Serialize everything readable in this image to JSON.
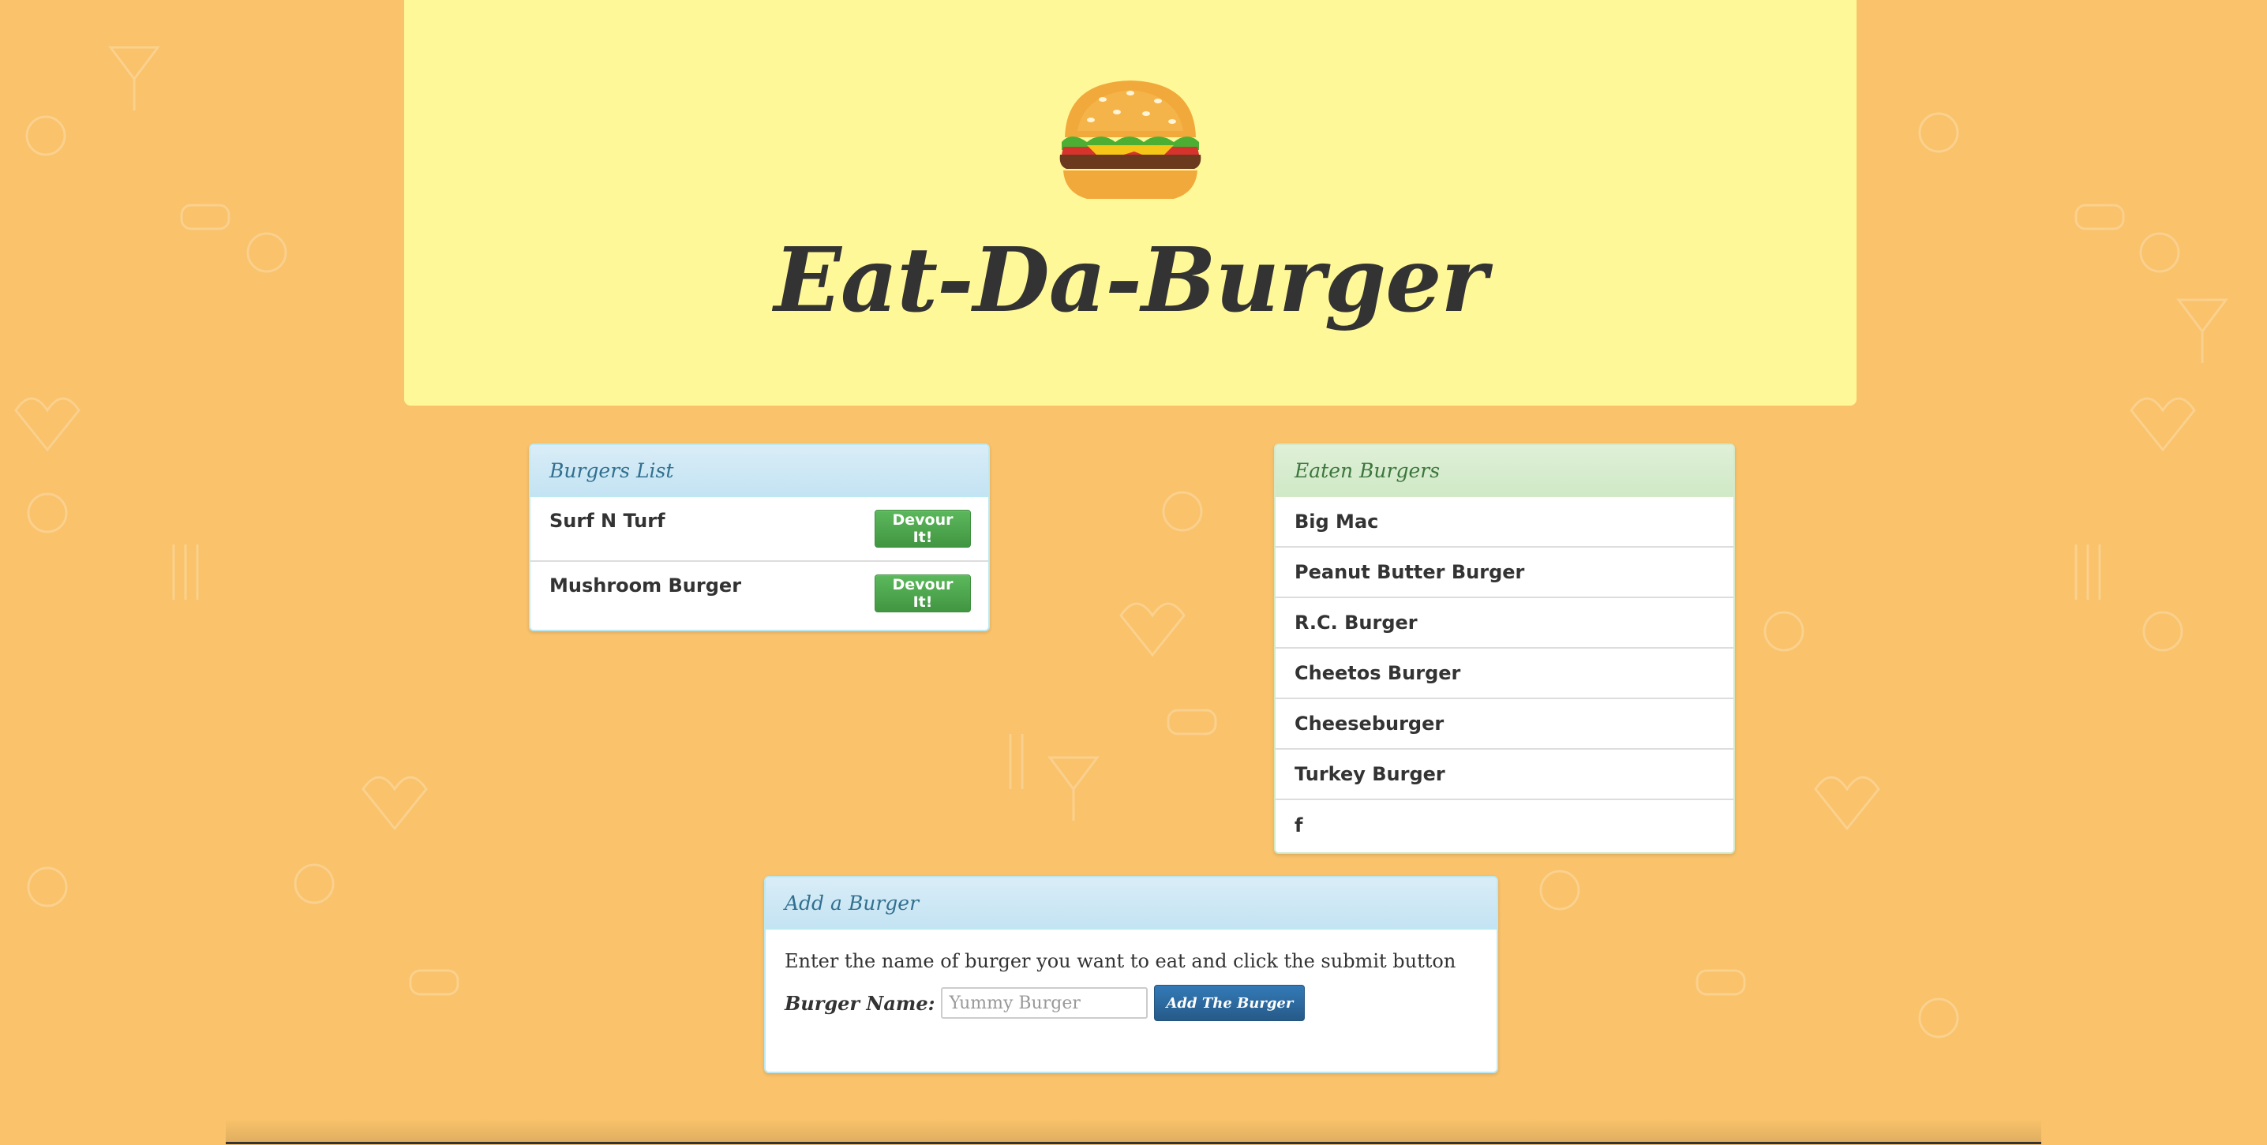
{
  "header": {
    "title": "Eat-Da-Burger",
    "logo_icon": "hamburger-icon"
  },
  "burgers_panel": {
    "heading": "Burgers List",
    "items": [
      {
        "name": "Surf N Turf",
        "button_label": "Devour It!"
      },
      {
        "name": "Mushroom Burger",
        "button_label": "Devour It!"
      }
    ]
  },
  "eaten_panel": {
    "heading": "Eaten Burgers",
    "items": [
      "Big Mac",
      "Peanut Butter Burger",
      "R.C. Burger",
      "Cheetos Burger",
      "Cheeseburger",
      "Turkey Burger",
      "f"
    ]
  },
  "add_panel": {
    "heading": "Add a Burger",
    "instructions": "Enter the name of burger you want to eat and click the submit button",
    "label": "Burger Name:",
    "input_value": "",
    "placeholder": "Yummy Burger",
    "submit_label": "Add The Burger"
  },
  "colors": {
    "background": "#f9c26b",
    "jumbotron": "#fff899",
    "info_heading": "#d9edf7",
    "success_heading": "#dff0d8",
    "devour_button": "#5cb85c",
    "primary_button": "#337ab7"
  }
}
